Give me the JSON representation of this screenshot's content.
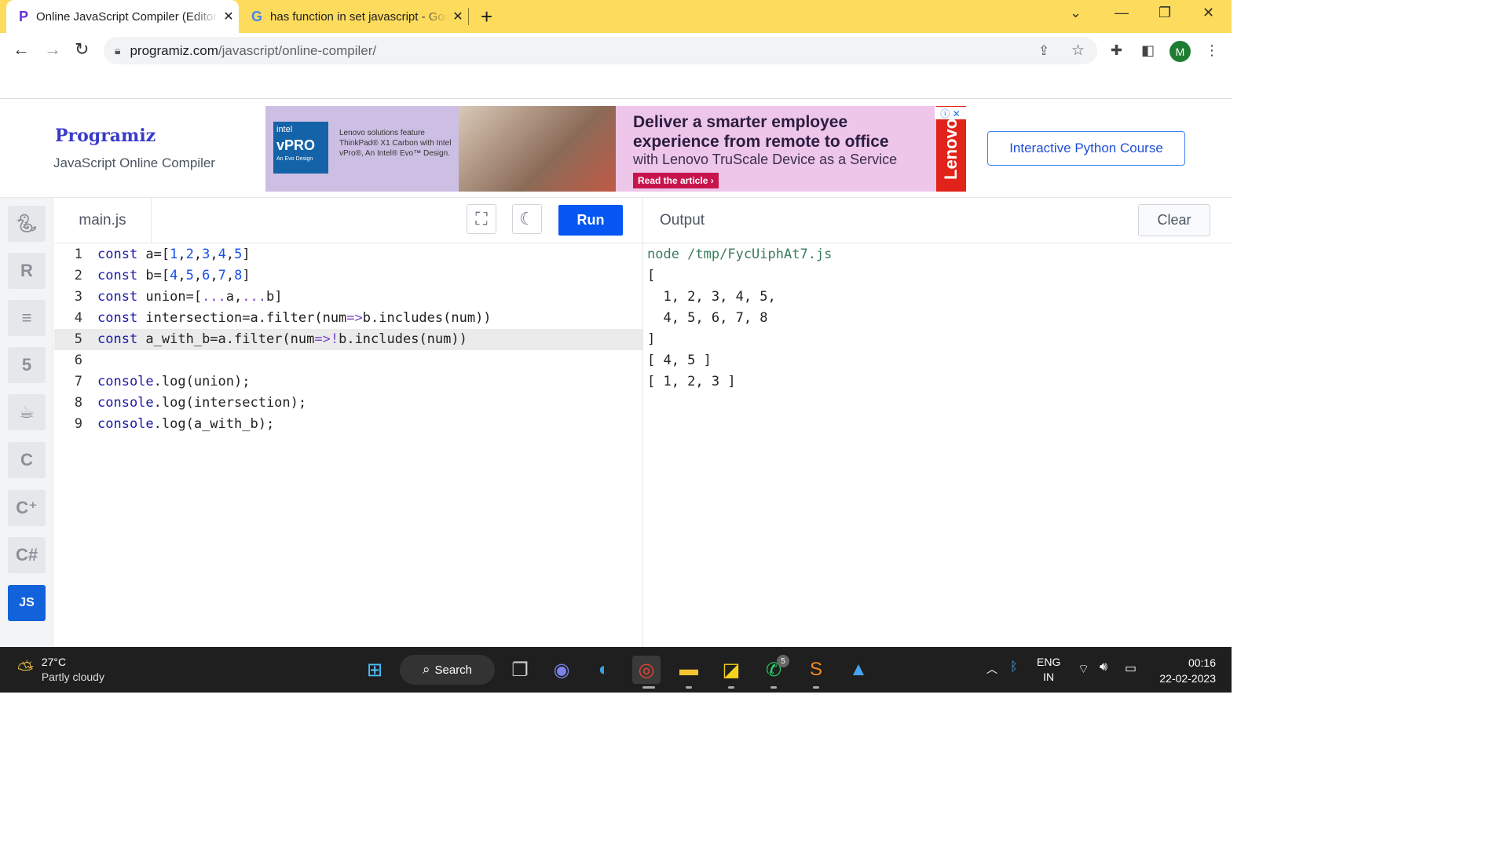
{
  "browser": {
    "tabs": [
      {
        "title": "Online JavaScript Compiler (Editor)",
        "icon": "programiz-favicon",
        "active": true
      },
      {
        "title": "has function in set javascript - Google Search",
        "icon": "google-favicon",
        "active": false
      }
    ],
    "url_host": "programiz.com",
    "url_path": "/javascript/online-compiler/",
    "avatar_letter": "M"
  },
  "header": {
    "logo": "Programiz",
    "subtitle": "JavaScript Online Compiler",
    "ad": {
      "intel_brand": "intel",
      "intel_vpro": "vPRO",
      "intel_evo": "An Evo Design",
      "small_text": "Lenovo solutions feature ThinkPad® X1 Carbon with Intel vPro®, An Intel® Evo™ Design.",
      "headline": "Deliver a smarter employee experience from remote to office",
      "sub": "with Lenovo TruScale Device as a Service",
      "cta": "Read the article ›",
      "brand": "Lenovo"
    },
    "course_button": "Interactive Python Course"
  },
  "editor": {
    "filename": "main.js",
    "run_label": "Run",
    "lines": [
      {
        "no": "1"
      },
      {
        "no": "2"
      },
      {
        "no": "3"
      },
      {
        "no": "4"
      },
      {
        "no": "5"
      },
      {
        "no": "6"
      },
      {
        "no": "7"
      },
      {
        "no": "8"
      },
      {
        "no": "9"
      }
    ]
  },
  "sidebar": {
    "languages": [
      "python-icon",
      "r-icon",
      "sql-icon",
      "html5-icon",
      "java-icon",
      "c-icon",
      "cpp-icon",
      "csharp-icon",
      "js-icon"
    ],
    "active_label": "JS"
  },
  "output": {
    "title": "Output",
    "clear_label": "Clear",
    "lines": [
      "node /tmp/FycUiphAt7.js",
      "[",
      "  1, 2, 3, 4, 5,",
      "  4, 5, 6, 7, 8",
      "]",
      "[ 4, 5 ]",
      "[ 1, 2, 3 ]"
    ]
  },
  "taskbar": {
    "temperature": "27°C",
    "weather": "Partly cloudy",
    "search_label": "Search",
    "whatsapp_badge": "5",
    "lang_line1": "ENG",
    "lang_line2": "IN",
    "time": "00:16",
    "date": "22-02-2023"
  },
  "colors": {
    "tabstrip": "#fddb5c",
    "run_button": "#0556f3",
    "active_lang": "#1262dc"
  }
}
